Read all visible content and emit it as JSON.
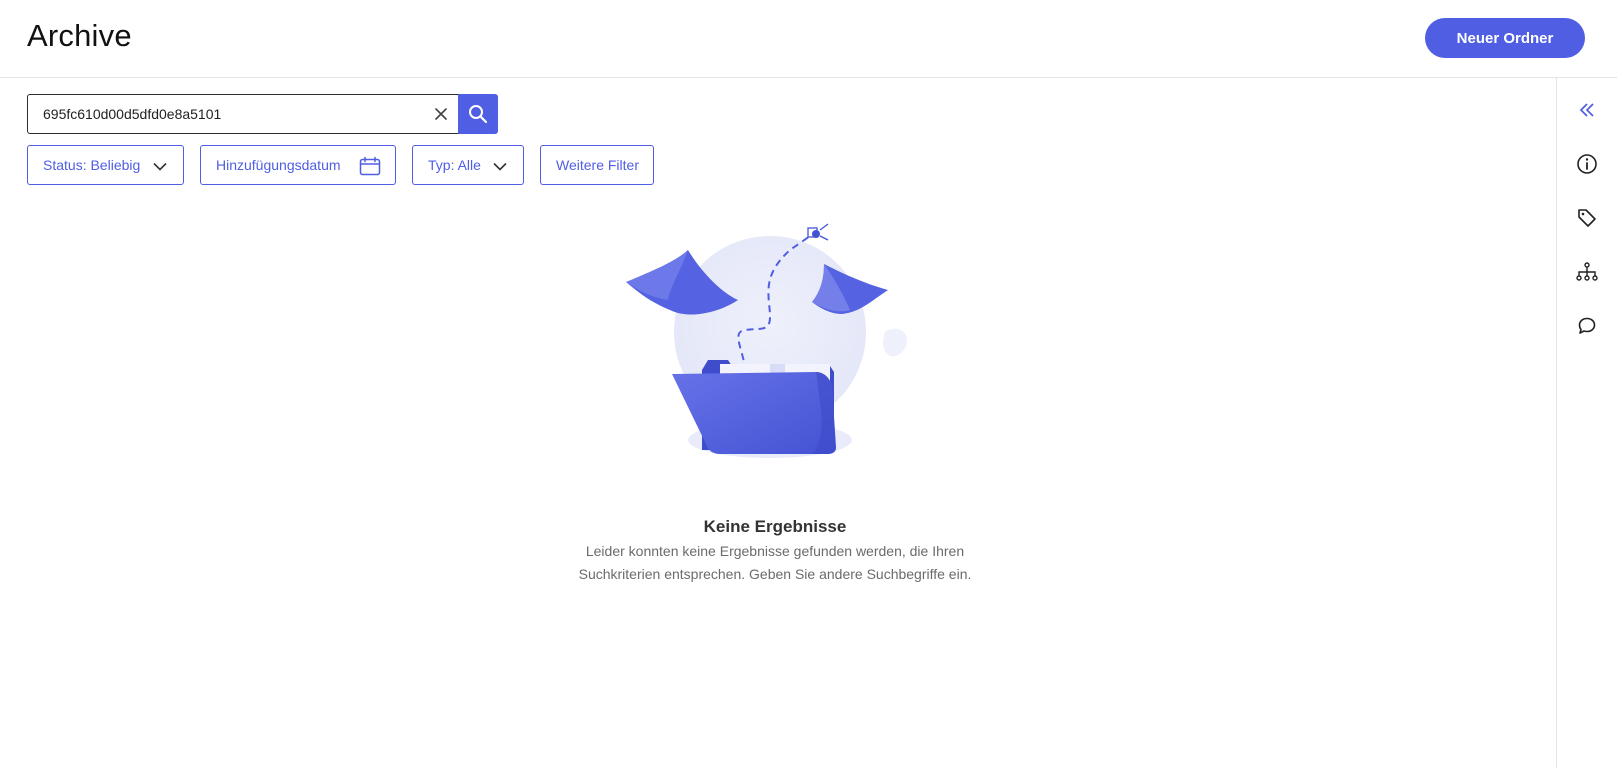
{
  "header": {
    "title": "Archive",
    "new_folder_label": "Neuer Ordner"
  },
  "search": {
    "value": "695fc610d00d5dfd0e8a5101",
    "placeholder": ""
  },
  "filters": {
    "status_label": "Status: Beliebig",
    "date_label": "Hinzufügungsdatum",
    "type_label": "Typ: Alle",
    "more_label": "Weitere Filter"
  },
  "empty_state": {
    "title": "Keine Ergebnisse",
    "line1": "Leider konnten keine Ergebnisse gefunden werden, die Ihren",
    "line2": "Suchkriterien entsprechen. Geben Sie andere Suchbegriffe ein."
  },
  "sidebar_icons": [
    "collapse-icon",
    "info-icon",
    "tag-icon",
    "hierarchy-icon",
    "comment-icon"
  ],
  "colors": {
    "accent": "#4f5ee3",
    "text": "#111111",
    "muted": "#6b6b6b",
    "border": "#e3e4e8"
  }
}
